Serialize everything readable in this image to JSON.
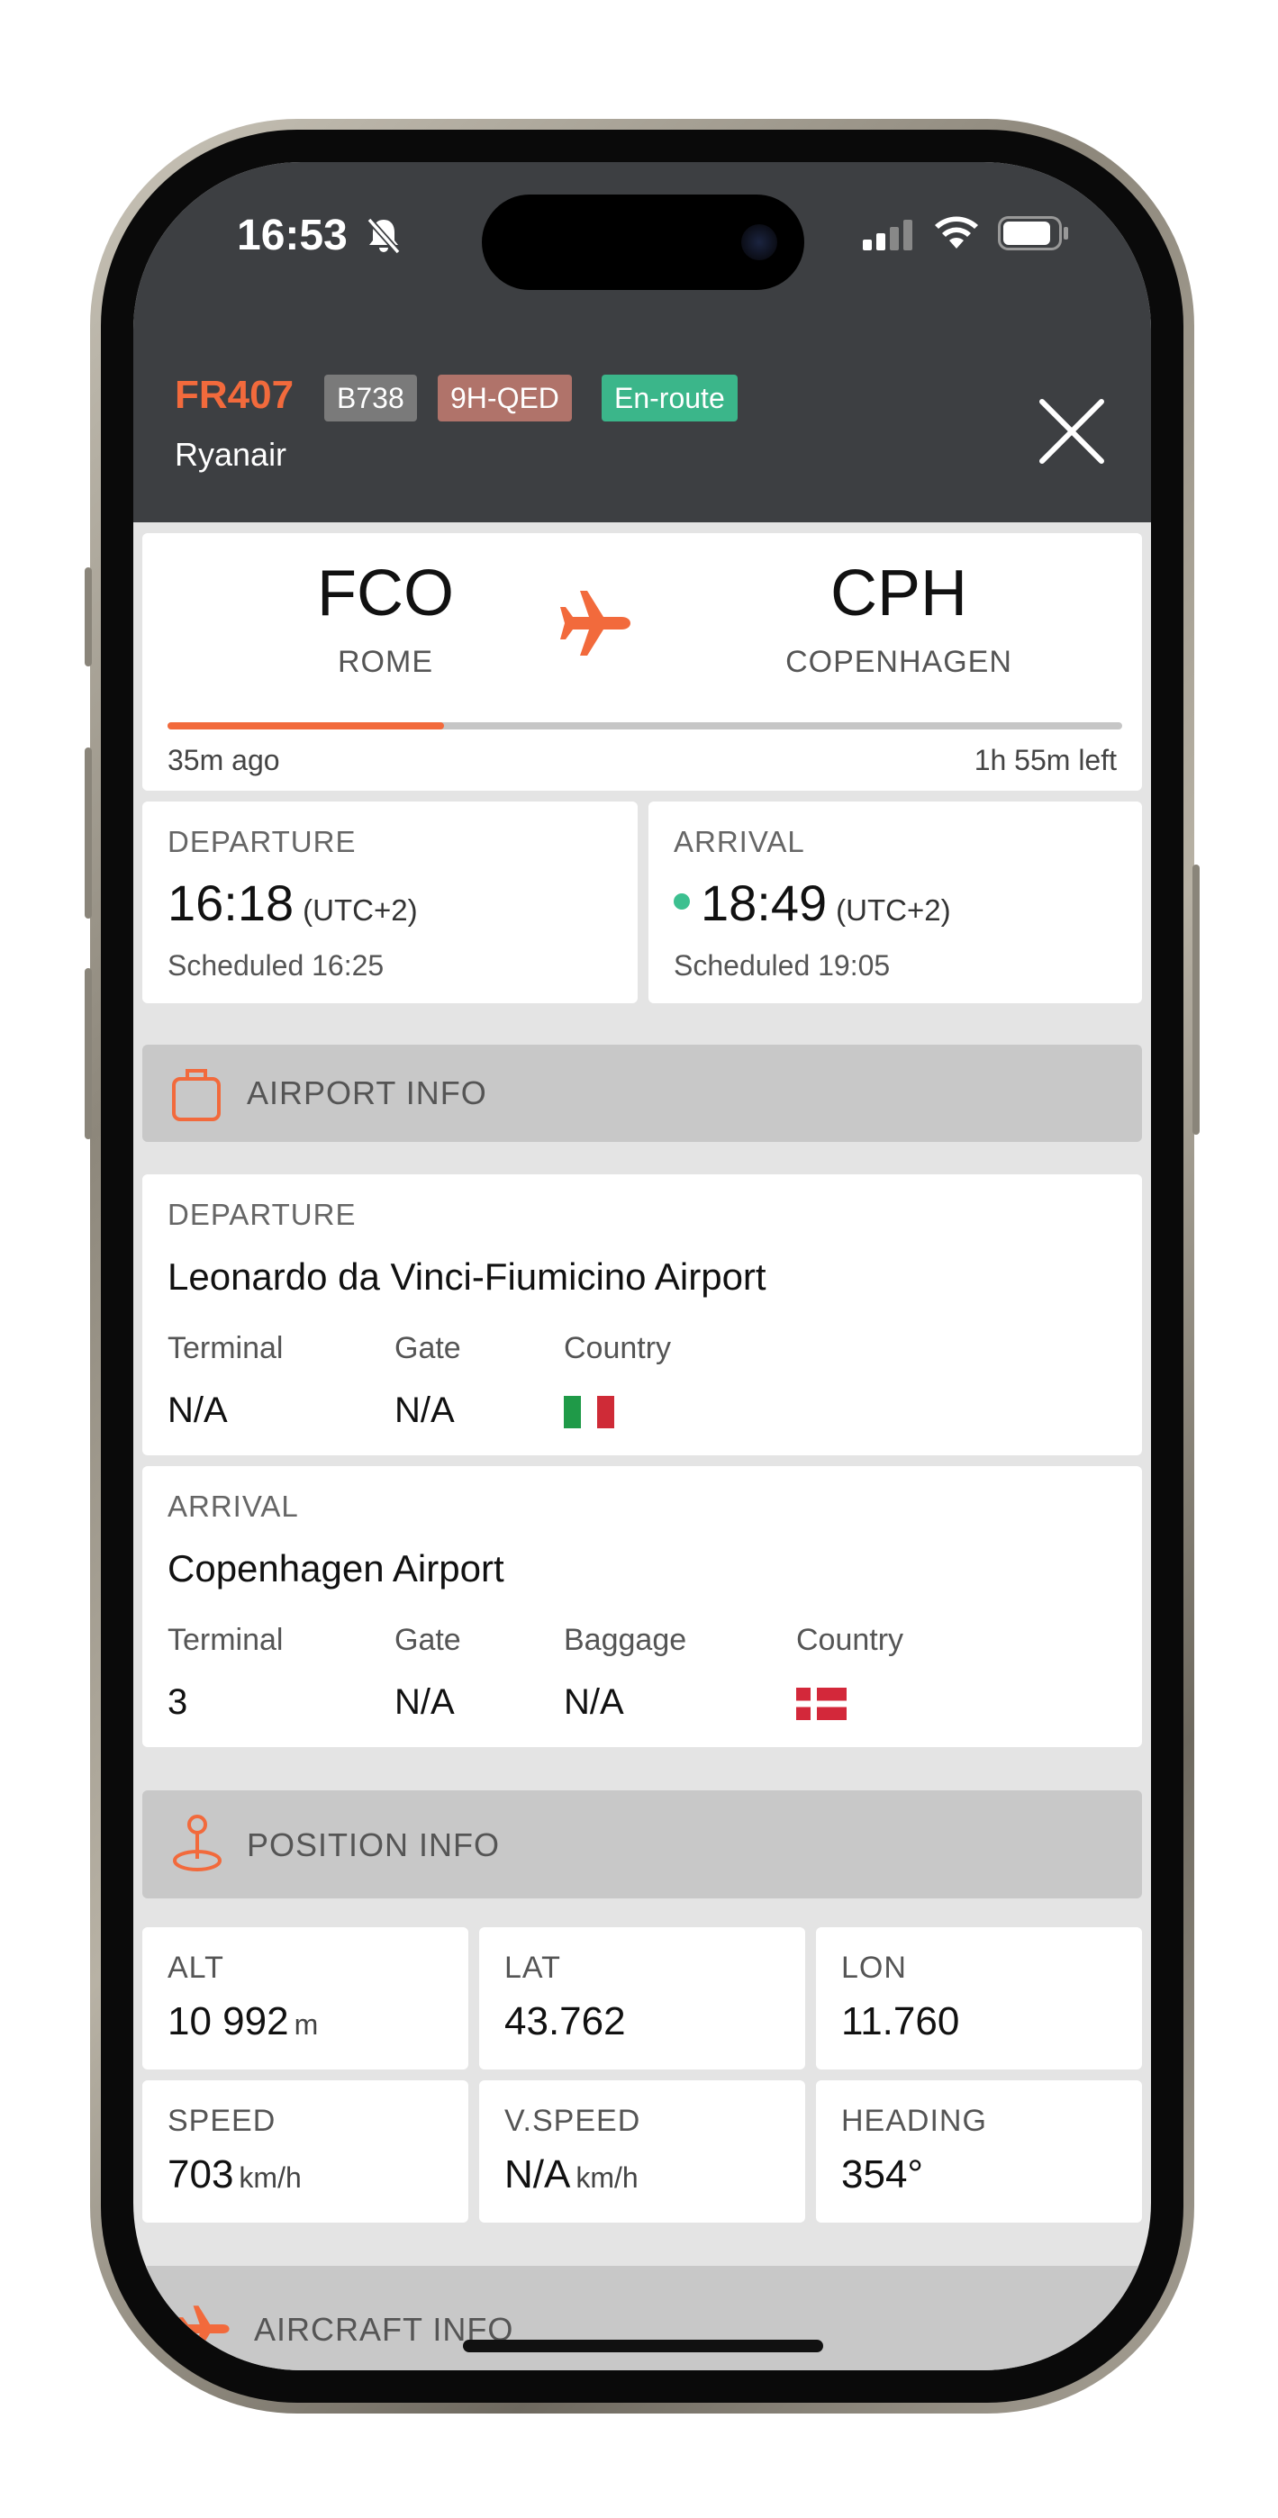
{
  "status_bar": {
    "time": "16:53"
  },
  "header": {
    "flight_number": "FR407",
    "aircraft_type": "B738",
    "registration": "9H-QED",
    "status": "En-route",
    "airline": "Ryanair",
    "colors": {
      "accent": "#f26a3c",
      "type_badge": "#7a7a7a",
      "reg_badge": "#b0736a",
      "status_badge": "#3bb68a"
    }
  },
  "route": {
    "origin_code": "FCO",
    "origin_city": "ROME",
    "destination_code": "CPH",
    "destination_city": "COPENHAGEN",
    "elapsed": "35m ago",
    "remaining": "1h 55m left",
    "progress": 0.29
  },
  "times": {
    "departure": {
      "label": "DEPARTURE",
      "time": "16:18",
      "utc": "(UTC+2)",
      "scheduled": "Scheduled 16:25"
    },
    "arrival": {
      "label": "ARRIVAL",
      "time": "18:49",
      "utc": "(UTC+2)",
      "scheduled": "Scheduled 19:05"
    }
  },
  "airport_info": {
    "title": "AIRPORT INFO",
    "departure": {
      "label": "DEPARTURE",
      "name": "Leonardo da Vinci-Fiumicino Airport",
      "terminal_label": "Terminal",
      "terminal": "N/A",
      "gate_label": "Gate",
      "gate": "N/A",
      "country_label": "Country",
      "country_flag": "italy-flag"
    },
    "arrival": {
      "label": "ARRIVAL",
      "name": "Copenhagen Airport",
      "terminal_label": "Terminal",
      "terminal": "3",
      "gate_label": "Gate",
      "gate": "N/A",
      "baggage_label": "Baggage",
      "baggage": "N/A",
      "country_label": "Country",
      "country_flag": "denmark-flag"
    }
  },
  "position_info": {
    "title": "POSITION INFO",
    "alt_label": "ALT",
    "alt": "10 992",
    "alt_unit": "m",
    "lat_label": "LAT",
    "lat": "43.762",
    "lon_label": "LON",
    "lon": "11.760",
    "speed_label": "SPEED",
    "speed": "703",
    "speed_unit": "km/h",
    "vspeed_label": "V.SPEED",
    "vspeed": "N/A",
    "vspeed_unit": "km/h",
    "heading_label": "HEADING",
    "heading": "354°"
  },
  "aircraft_info": {
    "title": "AIRCRAFT INFO"
  }
}
